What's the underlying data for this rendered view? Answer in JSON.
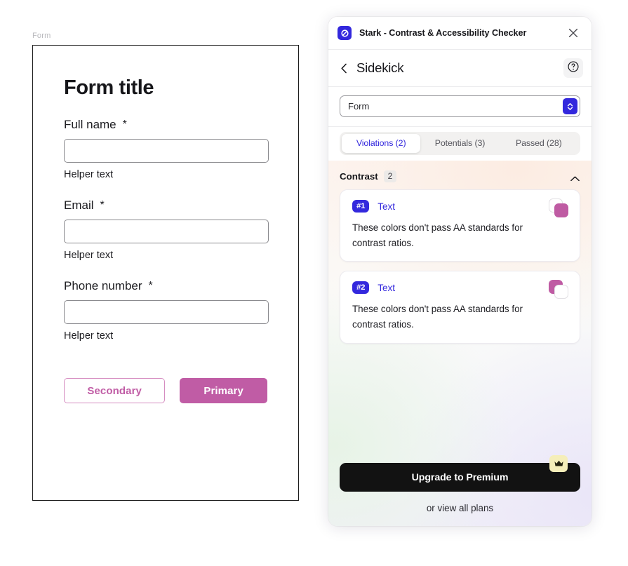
{
  "canvas": {
    "frame_label": "Form",
    "form": {
      "title": "Form title",
      "fields": [
        {
          "label": "Full name",
          "required_mark": "*",
          "value": "",
          "helper": "Helper text"
        },
        {
          "label": "Email",
          "required_mark": "*",
          "value": "",
          "helper": "Helper text"
        },
        {
          "label": "Phone number",
          "required_mark": "*",
          "value": "",
          "helper": "Helper text"
        }
      ],
      "buttons": {
        "secondary_label": "Secondary",
        "primary_label": "Primary",
        "secondary_color": "#c05ca5",
        "primary_bg": "#c05ca5",
        "primary_text_color": "#ffffff"
      }
    }
  },
  "plugin": {
    "titlebar": {
      "logo_icon": "stark-logo-icon",
      "title": "Stark - Contrast & Accessibility Checker",
      "close_icon": "close-icon",
      "brand_color": "#3328dd"
    },
    "nav": {
      "back_icon": "chevron-left-icon",
      "title": "Sidekick",
      "help_icon": "question-mark-icon"
    },
    "scope_select": {
      "value": "Form",
      "stepper_icon": "chevron-up-down-icon"
    },
    "tabs": [
      {
        "label": "Violations (2)",
        "active": true
      },
      {
        "label": "Potentials (3)",
        "active": false
      },
      {
        "label": "Passed (28)",
        "active": false
      }
    ],
    "section": {
      "title": "Contrast",
      "count": "2",
      "collapse_icon": "chevron-up-icon"
    },
    "issues": [
      {
        "number": "#1",
        "link_label": "Text",
        "description": "These colors don't pass AA standards for contrast ratios.",
        "swatch_front": "pink",
        "swatch_color": "#bf5ba3"
      },
      {
        "number": "#2",
        "link_label": "Text",
        "description": "These colors don't pass AA standards for contrast ratios.",
        "swatch_front": "white",
        "swatch_color": "#bf5ba3"
      }
    ],
    "cta": {
      "crown_icon": "crown-icon",
      "upgrade_label": "Upgrade to Premium",
      "plans_label": "or view all plans"
    }
  }
}
